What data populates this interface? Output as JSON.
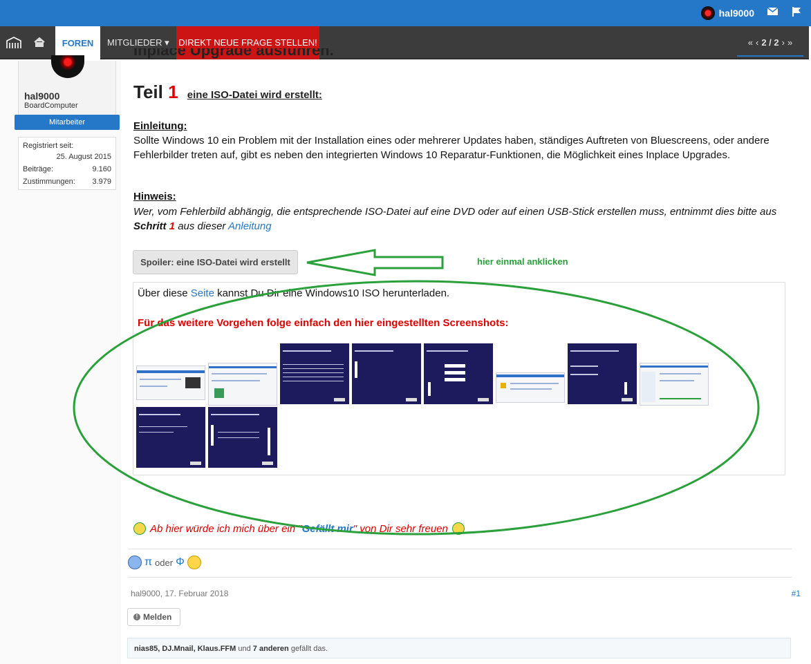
{
  "topbar": {
    "username": "hal9000"
  },
  "nav": {
    "foren": "FOREN",
    "mitglieder": "MITGLIEDER",
    "direkt": "DIREKT NEUE FRAGE STELLEN!",
    "pager": "2 / 2"
  },
  "author": {
    "name": "hal9000",
    "title": "BoardComputer",
    "badge": "Mitarbeiter",
    "registered_label": "Registriert seit:",
    "registered_value": "25. August 2015",
    "posts_label": "Beiträge:",
    "posts_value": "9.160",
    "likes_label": "Zustimmungen:",
    "likes_value": "3.979"
  },
  "post": {
    "partial_title": "Inplace Upgrade ausführen.",
    "teil_word": "Teil",
    "teil_num": "1",
    "teil_sub": "eine ISO-Datei wird erstellt:",
    "einleitung_heading": "Einleitung:",
    "einleitung_text": "Sollte Windows 10 ein Problem mit der Installation eines oder mehrerer Updates haben, ständiges Auftreten von Bluescreens, oder andere Fehlerbilder treten auf, gibt es neben den integrierten Windows 10 Reparatur-Funktionen, die Möglichkeit eines Inplace Upgrades.",
    "hinweis_heading": "Hinweis:",
    "hinweis_text_a": "Wer, vom Fehlerbild abhängig, die entsprechende ISO-Datei auf eine DVD oder auf einen USB-Stick erstellen muss, entnimmt dies bitte aus ",
    "hinweis_schritt": "Schritt ",
    "hinweis_num": "1",
    "hinweis_text_b": " aus dieser ",
    "hinweis_link": "Anleitung",
    "spoiler_label": "Spoiler: eine ISO-Datei wird erstellt",
    "annotation_hint": "hier einmal anklicken",
    "spoiler_text_a": "Über diese ",
    "spoiler_link": "Seite",
    "spoiler_text_b": " kannst Du Dir eine Windows10 ISO herunterladen.",
    "spoiler_red": "Für das weitere Vorgehen folge einfach den hier eingestellten Screenshots:",
    "like_text_a": "Ab hier würde ich mich über ein \"",
    "like_text_q": "Gefällt mir",
    "like_text_b": "\" von Dir sehr freuen",
    "sig_pi": "π",
    "sig_oder": "oder",
    "sig_phi": "Φ",
    "meta": "hal9000, 17. Februar 2018",
    "postnum": "#1",
    "report": "Melden",
    "likes_users": "nias85, DJ.Mnail, Klaus.FFM",
    "likes_und": " und ",
    "likes_others": "7 anderen",
    "likes_tail": " gefällt das."
  },
  "colors": {
    "accent": "#2577c8",
    "nav_bg": "#3c3c3c",
    "direkt_bg": "#cc1414",
    "annotation_green": "#2aa03a",
    "red_text": "#e00000"
  }
}
